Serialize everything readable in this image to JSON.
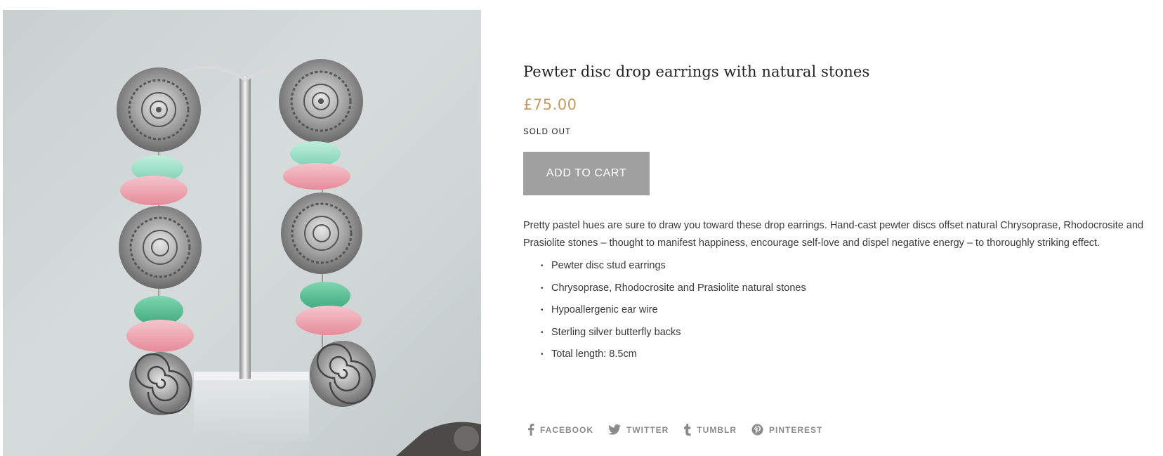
{
  "product": {
    "image_alt": "Pewter disc drop earrings on a stand",
    "title": "Pewter disc drop earrings with natural stones",
    "price": "£75.00",
    "status": "SOLD OUT",
    "add_to_cart_label": "ADD TO CART",
    "description": "Pretty pastel hues are sure to draw you toward these drop earrings. Hand-cast pewter discs offset natural Chrysoprase, Rhodocrosite and Prasiolite stones – thought to manifest happiness, encourage self-love and dispel negative energy – to thoroughly striking effect.",
    "features": [
      "Pewter disc stud earrings",
      "Chrysoprase, Rhodocrosite and Prasiolite natural stones",
      "Hypoallergenic ear wire",
      "Sterling silver butterfly backs",
      "Total length: 8.5cm"
    ],
    "bullet": "•"
  },
  "share": {
    "facebook": {
      "label": "FACEBOOK",
      "icon": "facebook-icon"
    },
    "twitter": {
      "label": "TWITTER",
      "icon": "twitter-icon"
    },
    "tumblr": {
      "label": "TUMBLR",
      "icon": "tumblr-icon"
    },
    "pinterest": {
      "label": "PINTEREST",
      "icon": "pinterest-icon"
    }
  },
  "colors": {
    "price": "#c69b5e",
    "button": "#a0a0a0",
    "share_text": "#8b8b8b"
  }
}
